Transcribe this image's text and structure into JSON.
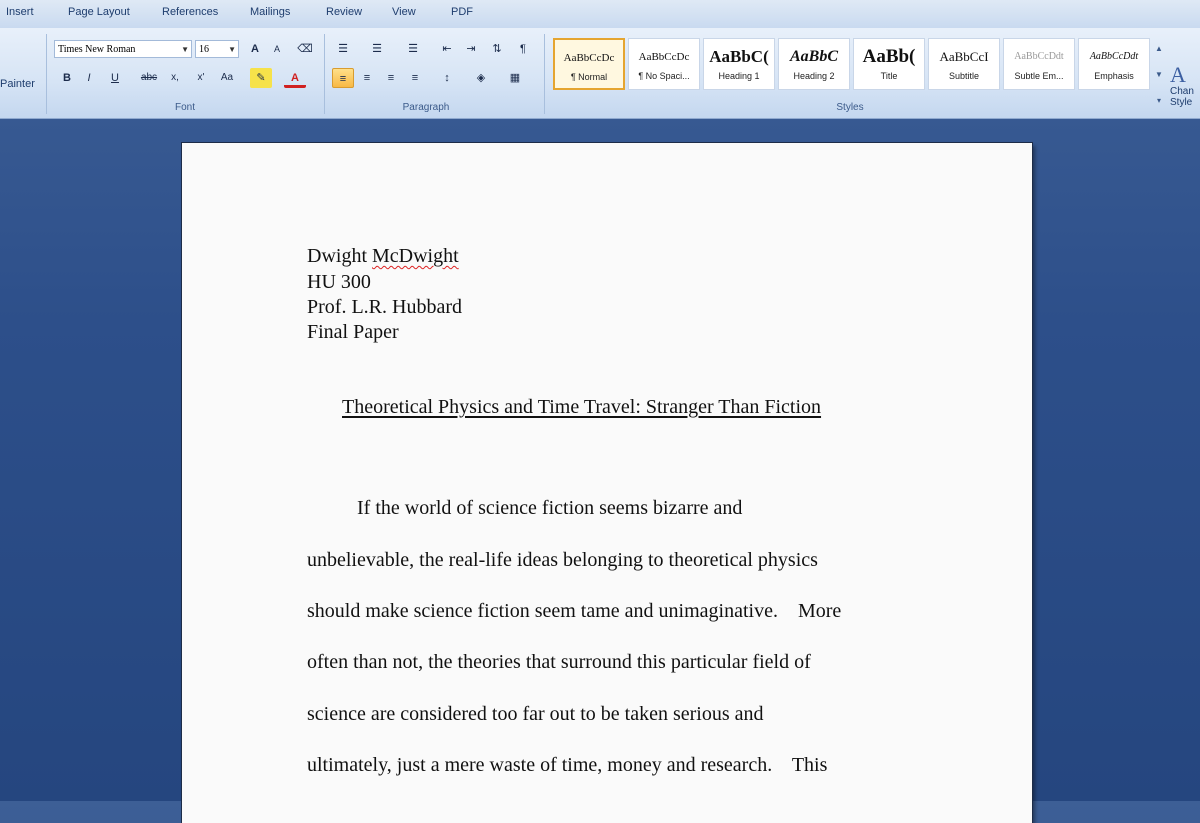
{
  "ribbon": {
    "tabs": [
      "Insert",
      "Page Layout",
      "References",
      "Mailings",
      "Review",
      "View",
      "PDF"
    ],
    "clipboard": {
      "format_painter_label": "Painter"
    },
    "font": {
      "font_name": "Times New Roman",
      "font_size": "16",
      "group_label": "Font",
      "buttons": [
        "A",
        "A",
        "aa",
        "B",
        "I",
        "U",
        "abc",
        "x,",
        "x'",
        "Aa",
        "A"
      ]
    },
    "paragraph": {
      "group_label": "Paragraph"
    },
    "styles": {
      "group_label": "Styles",
      "tiles": [
        {
          "sample": "AaBbCcDc",
          "name": "¶ Normal"
        },
        {
          "sample": "AaBbCcDc",
          "name": "¶ No Spaci..."
        },
        {
          "sample": "AaBbC(",
          "name": "Heading 1"
        },
        {
          "sample": "AaBbC",
          "name": "Heading 2"
        },
        {
          "sample": "AaBb(",
          "name": "Title"
        },
        {
          "sample": "AaBbCcI",
          "name": "Subtitle"
        },
        {
          "sample": "AaBbCcDdt",
          "name": "Subtle Em..."
        },
        {
          "sample": "AaBbCcDdt",
          "name": "Emphasis"
        }
      ],
      "change_styles_label_1": "Chan",
      "change_styles_label_2": "Style"
    }
  },
  "document": {
    "header_lines": [
      "Dwight McDwight",
      "HU 300",
      "Prof. L.R.  Hubbard",
      "Final Paper"
    ],
    "title": "Theoretical Physics and Time Travel: Stranger Than Fiction",
    "body_lines": [
      "If the world of science fiction seems bizarre and",
      "unbelievable, the real-life ideas belonging to theoretical physics",
      "should make science fiction seem tame and unimaginative.    More",
      "often than not, the theories that surround this particular field of",
      "science are considered too far out to be taken serious and",
      "ultimately, just a mere waste of time, money and research.    This"
    ]
  }
}
